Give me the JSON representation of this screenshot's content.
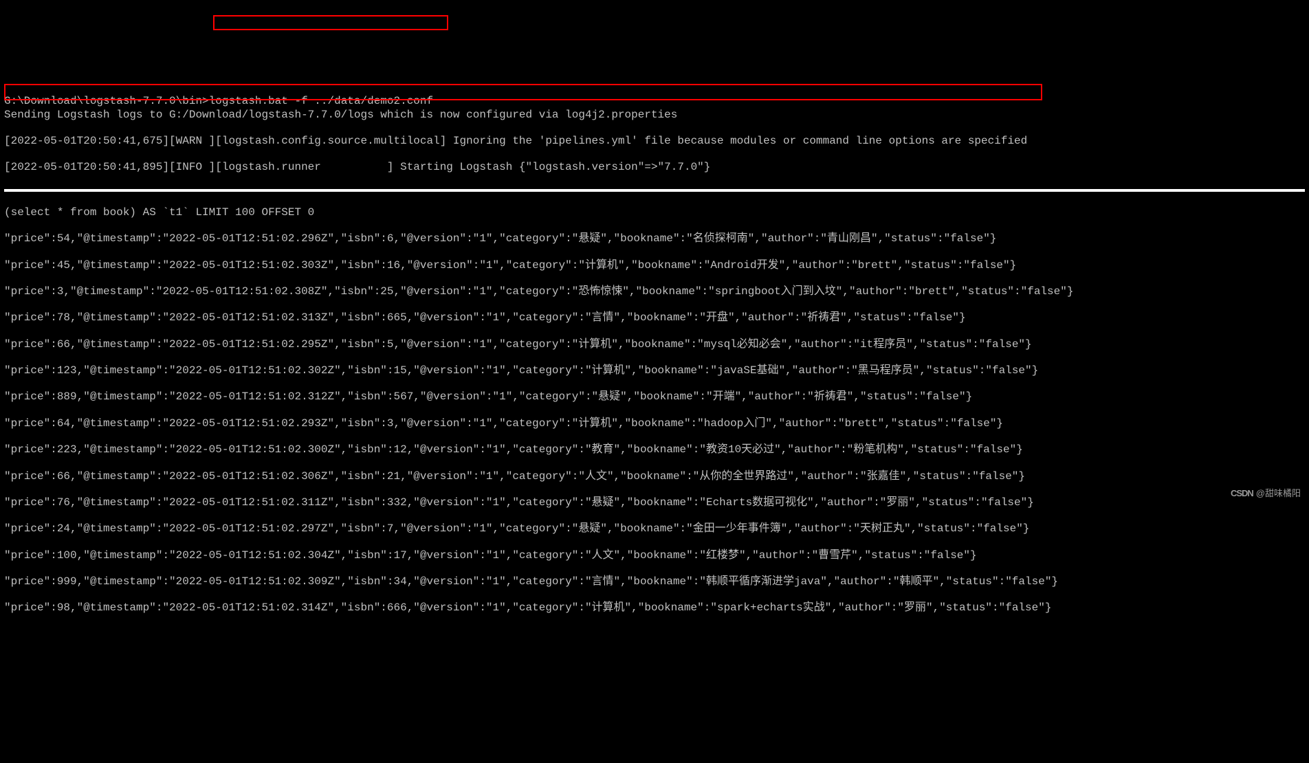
{
  "prompt": {
    "path": "G:\\Download\\logstash-7.7.0\\bin>",
    "command": "logstash.bat -f ../data/demo2.conf"
  },
  "log_lines": [
    "Sending Logstash logs to G:/Download/logstash-7.7.0/logs which is now configured via log4j2.properties",
    "[2022-05-01T20:50:41,675][WARN ][logstash.config.source.multilocal] Ignoring the 'pipelines.yml' file because modules or command line options are specified",
    "[2022-05-01T20:50:41,895][INFO ][logstash.runner          ] Starting Logstash {\"logstash.version\"=>\"7.7.0\"}"
  ],
  "sql_line": "(select * from book) AS `t1` LIMIT 100 OFFSET 0",
  "json_records": [
    "\"price\":54,\"@timestamp\":\"2022-05-01T12:51:02.296Z\",\"isbn\":6,\"@version\":\"1\",\"category\":\"悬疑\",\"bookname\":\"名侦探柯南\",\"author\":\"青山刚昌\",\"status\":\"false\"}",
    "\"price\":45,\"@timestamp\":\"2022-05-01T12:51:02.303Z\",\"isbn\":16,\"@version\":\"1\",\"category\":\"计算机\",\"bookname\":\"Android开发\",\"author\":\"brett\",\"status\":\"false\"}",
    "\"price\":3,\"@timestamp\":\"2022-05-01T12:51:02.308Z\",\"isbn\":25,\"@version\":\"1\",\"category\":\"恐怖惊悚\",\"bookname\":\"springboot入门到入坟\",\"author\":\"brett\",\"status\":\"false\"}",
    "\"price\":78,\"@timestamp\":\"2022-05-01T12:51:02.313Z\",\"isbn\":665,\"@version\":\"1\",\"category\":\"言情\",\"bookname\":\"开盘\",\"author\":\"祈祷君\",\"status\":\"false\"}",
    "\"price\":66,\"@timestamp\":\"2022-05-01T12:51:02.295Z\",\"isbn\":5,\"@version\":\"1\",\"category\":\"计算机\",\"bookname\":\"mysql必知必会\",\"author\":\"it程序员\",\"status\":\"false\"}",
    "\"price\":123,\"@timestamp\":\"2022-05-01T12:51:02.302Z\",\"isbn\":15,\"@version\":\"1\",\"category\":\"计算机\",\"bookname\":\"javaSE基础\",\"author\":\"黑马程序员\",\"status\":\"false\"}",
    "\"price\":889,\"@timestamp\":\"2022-05-01T12:51:02.312Z\",\"isbn\":567,\"@version\":\"1\",\"category\":\"悬疑\",\"bookname\":\"开端\",\"author\":\"祈祷君\",\"status\":\"false\"}",
    "\"price\":64,\"@timestamp\":\"2022-05-01T12:51:02.293Z\",\"isbn\":3,\"@version\":\"1\",\"category\":\"计算机\",\"bookname\":\"hadoop入门\",\"author\":\"brett\",\"status\":\"false\"}",
    "\"price\":223,\"@timestamp\":\"2022-05-01T12:51:02.300Z\",\"isbn\":12,\"@version\":\"1\",\"category\":\"教育\",\"bookname\":\"教资10天必过\",\"author\":\"粉笔机构\",\"status\":\"false\"}",
    "\"price\":66,\"@timestamp\":\"2022-05-01T12:51:02.306Z\",\"isbn\":21,\"@version\":\"1\",\"category\":\"人文\",\"bookname\":\"从你的全世界路过\",\"author\":\"张嘉佳\",\"status\":\"false\"}",
    "\"price\":76,\"@timestamp\":\"2022-05-01T12:51:02.311Z\",\"isbn\":332,\"@version\":\"1\",\"category\":\"悬疑\",\"bookname\":\"Echarts数据可视化\",\"author\":\"罗丽\",\"status\":\"false\"}",
    "\"price\":24,\"@timestamp\":\"2022-05-01T12:51:02.297Z\",\"isbn\":7,\"@version\":\"1\",\"category\":\"悬疑\",\"bookname\":\"金田一少年事件簿\",\"author\":\"天树正丸\",\"status\":\"false\"}",
    "\"price\":100,\"@timestamp\":\"2022-05-01T12:51:02.304Z\",\"isbn\":17,\"@version\":\"1\",\"category\":\"人文\",\"bookname\":\"红楼梦\",\"author\":\"曹雪芹\",\"status\":\"false\"}",
    "\"price\":999,\"@timestamp\":\"2022-05-01T12:51:02.309Z\",\"isbn\":34,\"@version\":\"1\",\"category\":\"言情\",\"bookname\":\"韩顺平循序渐进学java\",\"author\":\"韩顺平\",\"status\":\"false\"}",
    "\"price\":98,\"@timestamp\":\"2022-05-01T12:51:02.314Z\",\"isbn\":666,\"@version\":\"1\",\"category\":\"计算机\",\"bookname\":\"spark+echarts实战\",\"author\":\"罗丽\",\"status\":\"false\"}"
  ],
  "watermark": {
    "brand": "CSDN",
    "user": "@甜味橘阳"
  }
}
